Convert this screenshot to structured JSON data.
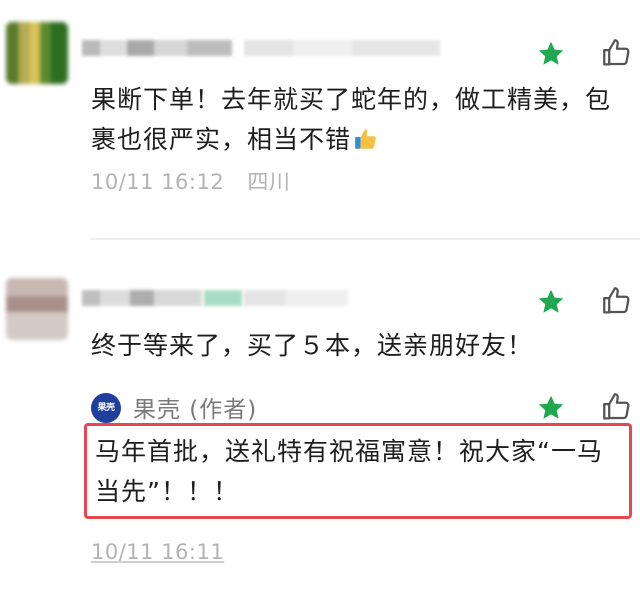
{
  "comments": [
    {
      "text_line1": "果断下单！去年就买了蛇年的，做工精美，包",
      "text_line2": "裹也很严实，相当不错",
      "date": "10/11 16:12",
      "location": "四川"
    },
    {
      "text_line1": "终于等来了，买了５本，送亲朋好友！"
    }
  ],
  "reply": {
    "badge": "果壳",
    "author": "果壳 (作者)",
    "text_line1": "马年首批，送礼特有祝福寓意！祝大家“一马",
    "text_line2": "当先”！！！",
    "date": "10/11 16:11"
  },
  "colors": {
    "star": "#1fa84f",
    "highlight": "#e8474f",
    "badge": "#1f3f9e"
  },
  "icons": [
    "star-icon",
    "thumbs-up-icon",
    "thumbs-up-emoji"
  ]
}
